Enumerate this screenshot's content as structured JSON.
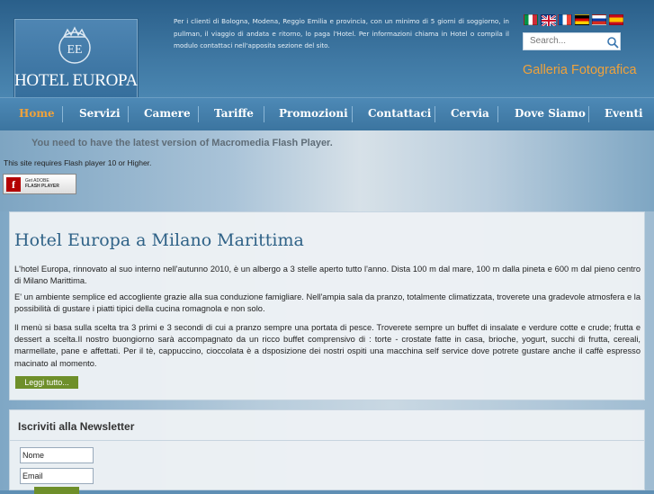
{
  "header": {
    "logo_text": "HOTEL EUROPA",
    "intro_text": "Per i clienti di Bologna, Modena, Reggio Emilia e provincia, con un minimo di 5 giorni di soggiorno, in pullman, il viaggio di andata e ritorno, lo paga l'Hotel. Per informazioni chiama in Hotel o compila il modulo contattaci nell'apposita sezione del sito.",
    "languages": [
      "italian-flag",
      "english-flag",
      "french-flag",
      "german-flag",
      "russian-flag",
      "spanish-flag"
    ],
    "search_placeholder": "Search...",
    "gallery_link": "Galleria Fotografica"
  },
  "nav": {
    "items": [
      "Home",
      "Servizi",
      "Camere",
      "Tariffe",
      "Promozioni",
      "Contattaci",
      "Cervia",
      "Dove Siamo",
      "Eventi"
    ],
    "active": "Home"
  },
  "flash": {
    "message": "You need to have the latest version of Macromedia Flash Player.",
    "requirement": "This site requires Flash player 10 or Higher.",
    "badge_line1": "Get ADOBE",
    "badge_line2": "FLASH PLAYER"
  },
  "main": {
    "title": "Hotel Europa a Milano Marittima",
    "paragraphs": [
      "L'hotel Europa, rinnovato al suo interno nell'autunno 2010, è un albergo a 3 stelle aperto tutto l'anno. Dista 100 m dal mare, 100 m dalla pineta e 600 m dal pieno centro di Milano Marittima.",
      "E' un ambiente semplice ed accogliente grazie alla sua conduzione famigliare. Nell'ampia sala da pranzo, totalmente climatizzata, troverete una gradevole atmosfera e la possibilità di gustare i piatti tipici della cucina romagnola e non solo.",
      "Il menù si basa sulla scelta tra 3 primi e 3 secondi di cui a pranzo sempre una portata di pesce. Troverete sempre un buffet di insalate e verdure cotte e crude; frutta e dessert a scelta.Il nostro buongiorno sarà accompagnato da un ricco buffet comprensivo di : torte - crostate fatte in casa, brioche, yogurt, succhi di frutta, cereali, marmellate, pane e affettati. Per il tè, cappuccino, cioccolata  è a dsposizione dei nostri ospiti una macchina self service dove potrete gustare  anche il caffè espresso macinato al momento."
    ],
    "read_more": "Leggi tutto..."
  },
  "newsletter": {
    "title": "Iscriviti alla Newsletter",
    "name_value": "Nome",
    "email_value": "Email"
  },
  "colors": {
    "accent_orange": "#f0a23b",
    "button_green": "#6e8f2a",
    "header_blue": "#2a5f8a"
  }
}
